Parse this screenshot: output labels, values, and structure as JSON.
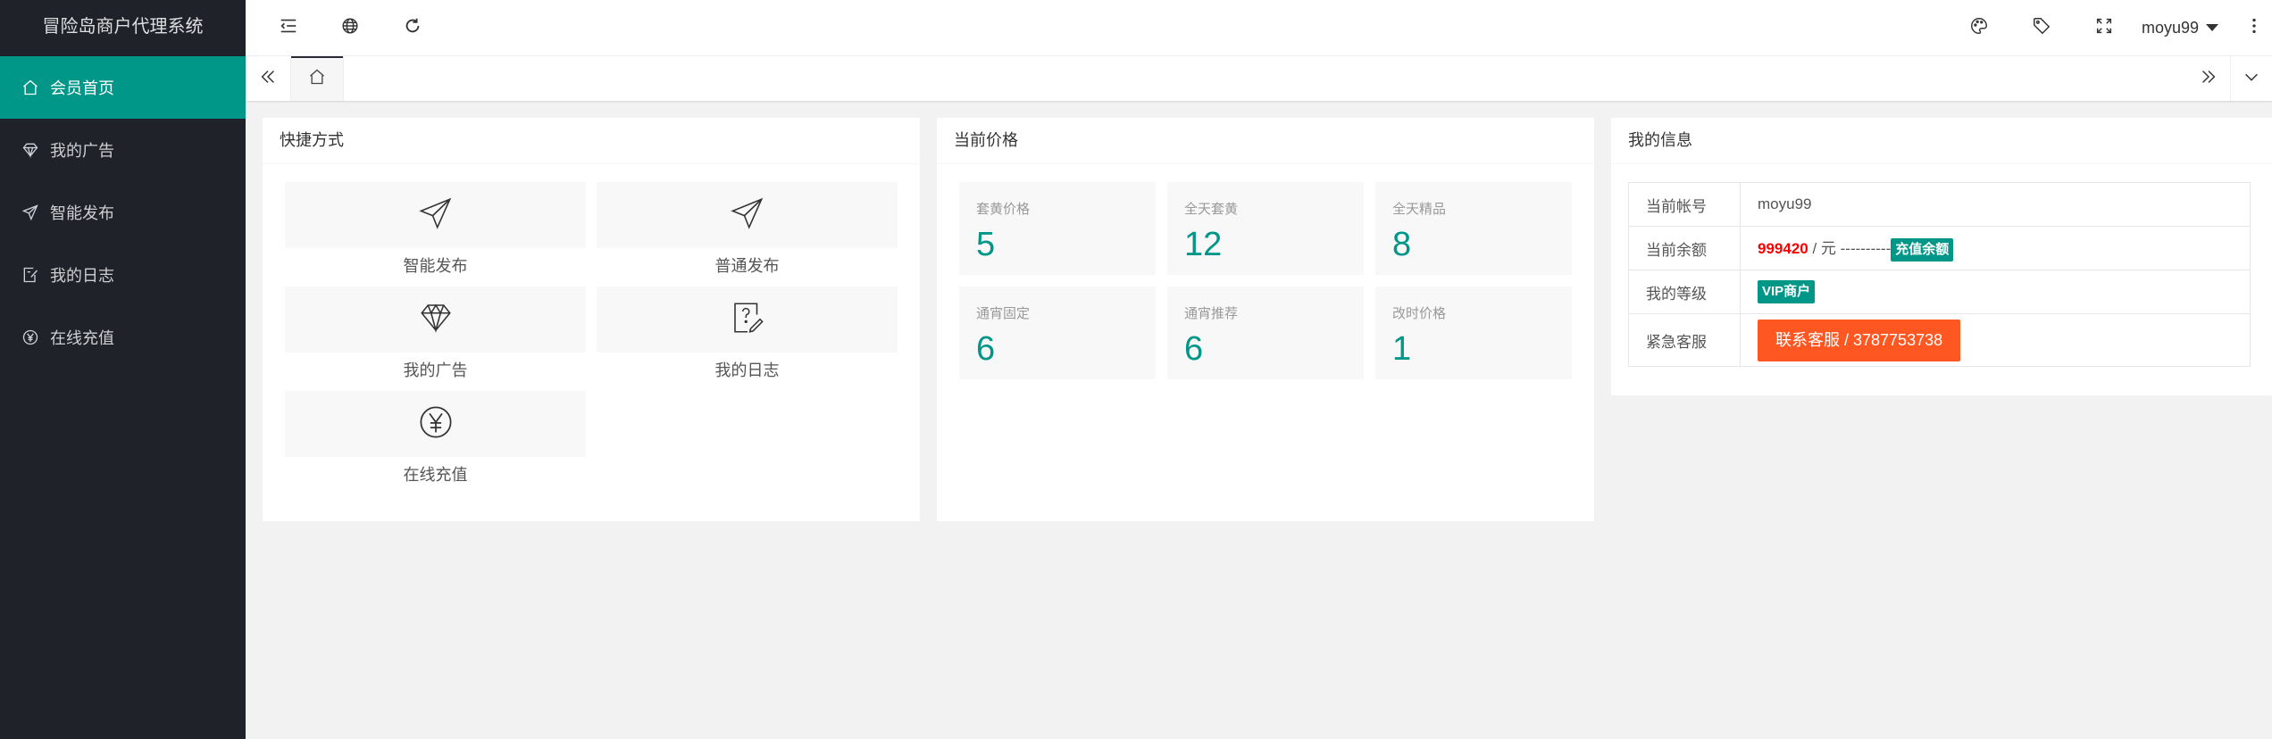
{
  "app": {
    "title": "冒险岛商户代理系统"
  },
  "sidebar": {
    "items": [
      {
        "label": "会员首页",
        "icon": "home-icon",
        "active": true
      },
      {
        "label": "我的广告",
        "icon": "diamond-icon"
      },
      {
        "label": "智能发布",
        "icon": "paper-plane-icon"
      },
      {
        "label": "我的日志",
        "icon": "log-edit-icon"
      },
      {
        "label": "在线充值",
        "icon": "yen-circle-icon"
      }
    ]
  },
  "header": {
    "username": "moyu99",
    "icons": [
      "menu-shrink-icon",
      "globe-icon",
      "refresh-icon",
      "theme-palette-icon",
      "tag-icon",
      "fullscreen-icon",
      "more-vertical-icon"
    ]
  },
  "tabs": {
    "home_icon": "home-icon"
  },
  "shortcuts": {
    "title": "快捷方式",
    "items": [
      {
        "label": "智能发布",
        "icon": "paper-plane-icon"
      },
      {
        "label": "普通发布",
        "icon": "paper-plane-icon"
      },
      {
        "label": "我的广告",
        "icon": "diamond-icon"
      },
      {
        "label": "我的日志",
        "icon": "log-question-icon"
      },
      {
        "label": "在线充值",
        "icon": "yen-circle-icon"
      }
    ]
  },
  "prices": {
    "title": "当前价格",
    "items": [
      {
        "label": "套黄价格",
        "value": "5"
      },
      {
        "label": "全天套黄",
        "value": "12"
      },
      {
        "label": "全天精品",
        "value": "8"
      },
      {
        "label": "通宵固定",
        "value": "6"
      },
      {
        "label": "通宵推荐",
        "value": "6"
      },
      {
        "label": "改时价格",
        "value": "1"
      }
    ]
  },
  "myinfo": {
    "title": "我的信息",
    "account_label": "当前帐号",
    "account_value": "moyu99",
    "balance_label": "当前余额",
    "balance_value": "999420",
    "balance_unit": " / 元 ----------",
    "recharge_label": "充值余额",
    "level_label": "我的等级",
    "level_value": "VIP商户",
    "support_label": "紧急客服",
    "support_button": "联系客服 / 3787753738"
  },
  "colors": {
    "accent": "#009688",
    "sidebar": "#20222a",
    "danger": "#ff5722"
  }
}
